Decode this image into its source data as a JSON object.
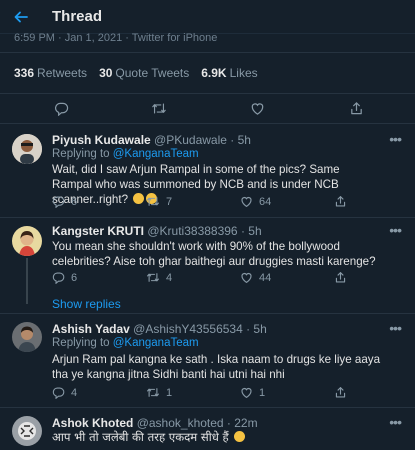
{
  "header": {
    "title": "Thread"
  },
  "tweet_meta": {
    "text": "6:59 PM · Jan 1, 2021 · Twitter for iPhone"
  },
  "stats": {
    "retweets_value": "336",
    "retweets_label": "Retweets",
    "quotes_value": "30",
    "quotes_label": "Quote Tweets",
    "likes_value": "6.9K",
    "likes_label": "Likes"
  },
  "replies": [
    {
      "name": "Piyush Kudawale",
      "handle": "@PKudawale · 5h",
      "replying_prefix": "Replying to",
      "replying_to": "@KanganaTeam",
      "text": "Wait, did I saw Arjun Rampal in some of the pics? Same Rampal who was summoned by NCB and is under NCB scanner..right?",
      "reply_count": "6",
      "retweet_count": "7",
      "like_count": "64"
    },
    {
      "name": "Kangster KRUTI",
      "handle": "@Kruti38388396 · 5h",
      "text": "You mean she shouldn't work with 90% of the bollywood celebrities? Aise toh ghar baithegi aur druggies masti karenge?",
      "reply_count": "6",
      "retweet_count": "4",
      "like_count": "44",
      "show_replies": "Show replies"
    },
    {
      "name": "Ashish Yadav",
      "handle": "@AshishY43556534 · 5h",
      "replying_prefix": "Replying to",
      "replying_to": "@KanganaTeam",
      "text": "Arjun Ram pal kangna ke sath . Iska naam to drugs ke liye aaya tha ye kangna jitna Sidhi banti hai utni hai nhi",
      "reply_count": "4",
      "retweet_count": "1",
      "like_count": "1"
    },
    {
      "name": "Ashok Khoted",
      "handle": "@ashok_khoted · 22m",
      "text": "आप भी तो जलेबी की तरह एकदम सीधे हैं"
    }
  ],
  "colors": {
    "background": "#15202b",
    "accent": "#1d9bf0",
    "muted": "#8899a6",
    "divider": "#263340"
  },
  "icons": [
    "back-arrow-icon",
    "reply-icon",
    "retweet-icon",
    "like-icon",
    "share-icon",
    "more-icon"
  ]
}
